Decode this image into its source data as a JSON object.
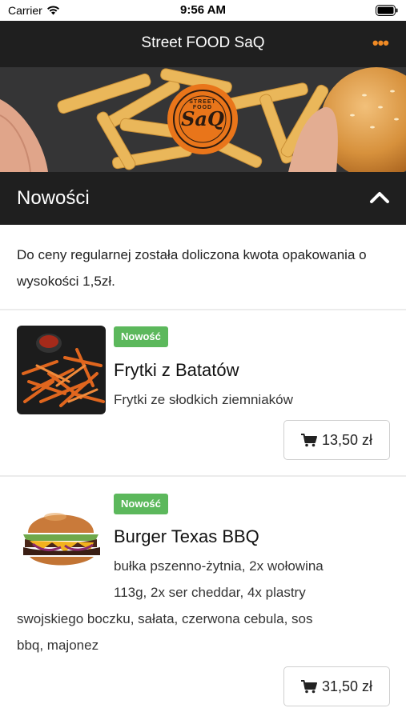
{
  "status_bar": {
    "carrier": "Carrier",
    "time": "9:56 AM"
  },
  "navbar": {
    "title": "Street FOOD SaQ",
    "more_icon": "•••"
  },
  "hero": {
    "logo_top_text": "STREET FOOD",
    "logo_main_text": "SaQ"
  },
  "section": {
    "title": "Nowości"
  },
  "info_note": "Do ceny regularnej została doliczona kwota opakowania o wysokości 1,5zł.",
  "products": [
    {
      "badge": "Nowość",
      "name": "Frytki z Batatów",
      "description": "Frytki ze słodkich ziemniaków",
      "price": "13,50 zł"
    },
    {
      "badge": "Nowość",
      "name": "Burger Texas BBQ",
      "description_line1": "bułka pszenno-żytnia, 2x wołowina",
      "description_line2": "113g, 2x ser cheddar, 4x plastry",
      "description_line3": "swojskiego boczku, sałata, czerwona cebula, sos",
      "description_line4": "bbq, majonez",
      "price": "31,50 zł"
    }
  ],
  "colors": {
    "navbar": "#1f1f1f",
    "accent": "#f08a24",
    "badge": "#5cb85c"
  }
}
